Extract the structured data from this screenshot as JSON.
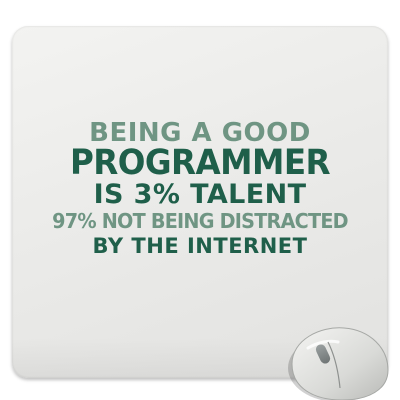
{
  "mousepad": {
    "lines": [
      "BEING A GOOD",
      "PROGRAMMER",
      "IS 3% TALENT",
      "97% NOT BEING DISTRACTED",
      "BY THE INTERNET"
    ]
  },
  "colors": {
    "dark_green": "#1f5f4a",
    "muted_green": "#6f9583",
    "pad_surface": "#ebebe9"
  }
}
